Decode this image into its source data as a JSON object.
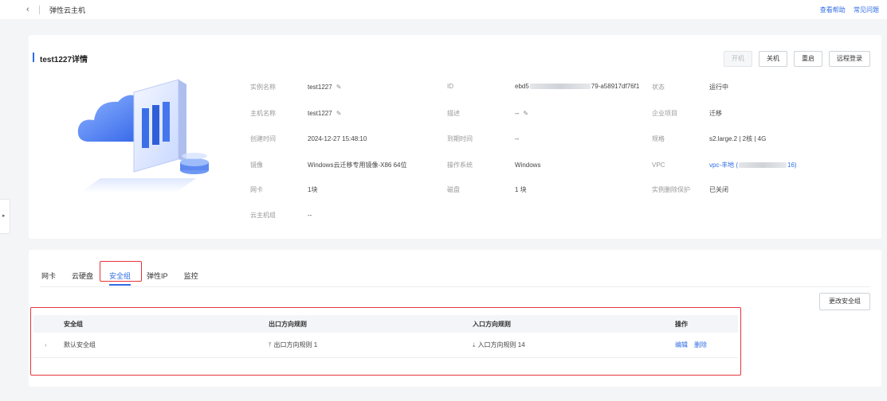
{
  "topbar": {
    "back_icon": "‹",
    "title": "弹性云主机",
    "help_link": "查看帮助",
    "faq_link": "常见问题"
  },
  "side_toggle": "▸",
  "detail": {
    "title": "test1227详情",
    "buttons": {
      "start": "开机",
      "stop": "关机",
      "restart": "重启",
      "remote": "远程登录"
    },
    "fields": {
      "instance_name_label": "实例名称",
      "instance_name": "test1227",
      "host_name_label": "主机名称",
      "host_name": "test1227",
      "created_label": "创建时间",
      "created": "2024-12-27 15:48:10",
      "image_label": "镜像",
      "image": "Windows云迁移专用镜像-X86 64位",
      "nic_label": "网卡",
      "nic": "1块",
      "group_label": "云主机组",
      "group": "--",
      "id_label": "ID",
      "id_prefix": "ebd5",
      "id_suffix": "79-a58917df76f1",
      "desc_label": "描述",
      "desc": "--",
      "expire_label": "到期时间",
      "expire": "--",
      "os_label": "操作系统",
      "os": "Windows",
      "disk_label": "磁盘",
      "disk": "1 块",
      "status_label": "状态",
      "status": "运行中",
      "project_label": "企业项目",
      "project": "迁移",
      "spec_label": "规格",
      "spec": "s2.large.2 | 2核 | 4G",
      "vpc_label": "VPC",
      "vpc_prefix": "vpc-丰地 (",
      "vpc_suffix": "16)",
      "delprot_label": "实例删除保护",
      "delprot": "已关闭"
    }
  },
  "tabs": [
    "网卡",
    "云硬盘",
    "安全组",
    "弹性IP",
    "监控"
  ],
  "change_sg_button": "更改安全组",
  "table": {
    "headers": {
      "name": "安全组",
      "outbound": "出口方向规则",
      "inbound": "入口方向规则",
      "ops": "操作"
    },
    "rows": [
      {
        "expand": "›",
        "name": "默认安全组",
        "outbound": "出口方向规则 1",
        "inbound": "入口方向规则 14",
        "edit": "编辑",
        "delete": "删除"
      }
    ]
  },
  "colors": {
    "accent": "#2f6ce5",
    "highlight": "#e5353b"
  }
}
